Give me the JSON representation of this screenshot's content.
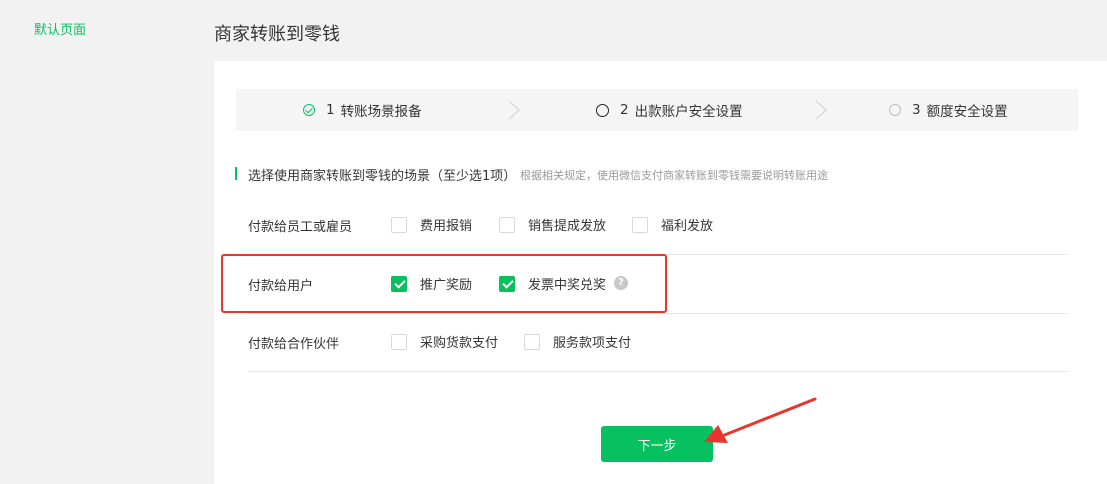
{
  "sidebar": {
    "items": [
      {
        "label": "默认页面"
      }
    ]
  },
  "page": {
    "title": "商家转账到零钱"
  },
  "steps": [
    {
      "num": "1",
      "label": "转账场景报备",
      "state": "active",
      "icon": "check-circle-icon"
    },
    {
      "num": "2",
      "label": "出款账户安全设置",
      "state": "pending",
      "icon": "circle-icon"
    },
    {
      "num": "3",
      "label": "额度安全设置",
      "state": "pending",
      "icon": "circle-icon"
    }
  ],
  "section": {
    "title": "选择使用商家转账到零钱的场景（至少选1项）",
    "note": "根据相关规定，使用微信支付商家转账到零钱需要说明转账用途"
  },
  "rows": [
    {
      "label": "付款给员工或雇员",
      "options": [
        {
          "label": "费用报销",
          "checked": false
        },
        {
          "label": "销售提成发放",
          "checked": false
        },
        {
          "label": "福利发放",
          "checked": false
        }
      ]
    },
    {
      "label": "付款给用户",
      "options": [
        {
          "label": "推广奖励",
          "checked": true
        },
        {
          "label": "发票中奖兑奖",
          "checked": true
        }
      ],
      "help": "?"
    },
    {
      "label": "付款给合作伙伴",
      "options": [
        {
          "label": "采购货款支付",
          "checked": false
        },
        {
          "label": "服务款项支付",
          "checked": false
        }
      ]
    }
  ],
  "buttons": {
    "next": "下一步"
  },
  "colors": {
    "accent": "#07c160",
    "highlight": "#e8352f"
  }
}
